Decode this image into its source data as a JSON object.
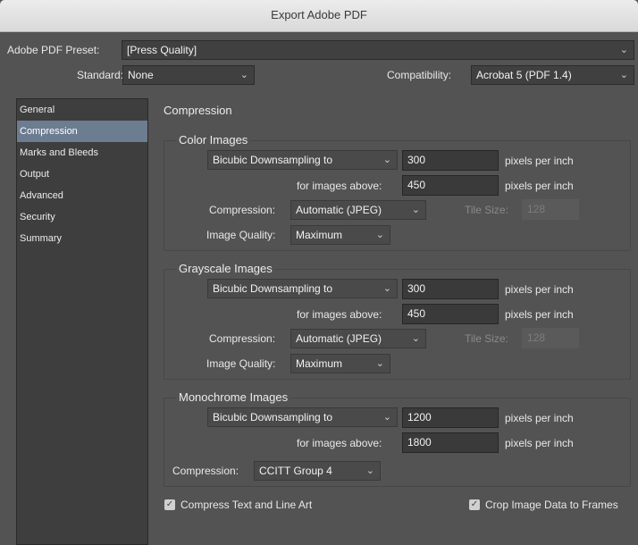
{
  "window": {
    "title": "Export Adobe PDF"
  },
  "header": {
    "preset_label": "Adobe PDF Preset:",
    "preset_value": "[Press Quality]",
    "standard_label": "Standard:",
    "standard_value": "None",
    "compat_label": "Compatibility:",
    "compat_value": "Acrobat 5 (PDF 1.4)"
  },
  "sidebar": {
    "items": [
      {
        "label": "General"
      },
      {
        "label": "Compression"
      },
      {
        "label": "Marks and Bleeds"
      },
      {
        "label": "Output"
      },
      {
        "label": "Advanced"
      },
      {
        "label": "Security"
      },
      {
        "label": "Summary"
      }
    ],
    "selected": "Compression"
  },
  "main": {
    "section_title": "Compression",
    "color": {
      "title": "Color Images",
      "downsample": "Bicubic Downsampling to",
      "ppi_value": "300",
      "ppi_unit": "pixels per inch",
      "above_label": "for images above:",
      "above_value": "450",
      "above_unit": "pixels per inch",
      "compression_label": "Compression:",
      "compression_value": "Automatic (JPEG)",
      "tile_label": "Tile Size:",
      "tile_value": "128",
      "quality_label": "Image Quality:",
      "quality_value": "Maximum"
    },
    "gray": {
      "title": "Grayscale Images",
      "downsample": "Bicubic Downsampling to",
      "ppi_value": "300",
      "ppi_unit": "pixels per inch",
      "above_label": "for images above:",
      "above_value": "450",
      "above_unit": "pixels per inch",
      "compression_label": "Compression:",
      "compression_value": "Automatic (JPEG)",
      "tile_label": "Tile Size:",
      "tile_value": "128",
      "quality_label": "Image Quality:",
      "quality_value": "Maximum"
    },
    "mono": {
      "title": "Monochrome Images",
      "downsample": "Bicubic Downsampling to",
      "ppi_value": "1200",
      "ppi_unit": "pixels per inch",
      "above_label": "for images above:",
      "above_value": "1800",
      "above_unit": "pixels per inch",
      "compression_label": "Compression:",
      "compression_value": "CCITT Group 4"
    },
    "options": {
      "compress_text": "Compress Text and Line Art",
      "crop_image": "Crop Image Data to Frames",
      "compress_checked": true,
      "crop_checked": true
    }
  },
  "icons": {
    "dropdown": "chevron-down-icon",
    "checkbox": "checkmark-icon"
  }
}
